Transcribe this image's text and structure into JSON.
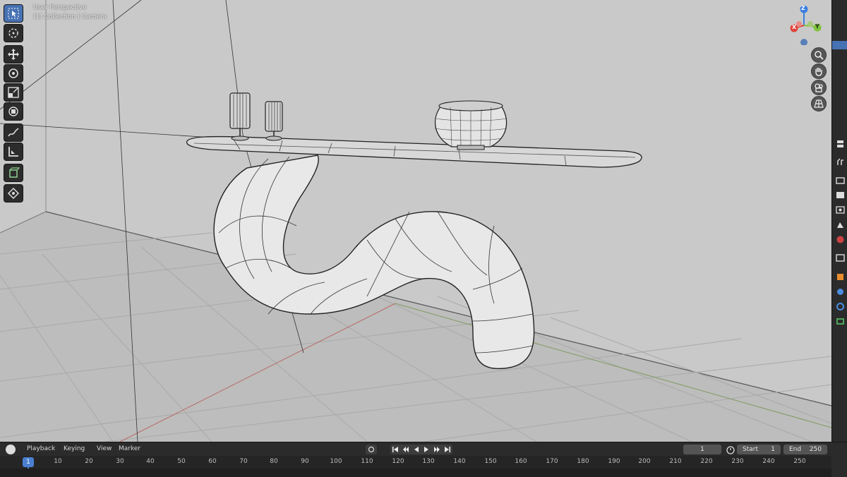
{
  "viewport": {
    "mode_label": "User Perspective",
    "collection_label": "(1) Collection | Camera",
    "gizmo_axes": {
      "z": "Z",
      "x": "X",
      "y": "Y"
    },
    "colors": {
      "x_axis": "#e0443c",
      "y_axis": "#7ec43a",
      "z_axis": "#3a7fe0",
      "background": "#c9c9c9",
      "floor": "#bebebe"
    }
  },
  "toolbar": {
    "tools": [
      "select-box-icon",
      "cursor-icon",
      "move-icon",
      "rotate-icon",
      "scale-icon",
      "transform-icon",
      "annotate-icon",
      "measure-icon",
      "add-cube-icon",
      "edit-object-icon"
    ]
  },
  "navigation": [
    "zoom-icon",
    "pan-hand-icon",
    "camera-view-icon",
    "orthographic-grid-icon"
  ],
  "properties_tabs": [
    "tool-icon",
    "render-icon",
    "output-icon",
    "view-layer-icon",
    "scene-icon",
    "world-icon",
    "collection-icon",
    "object-icon",
    "modifier-icon",
    "physics-icon",
    "data-icon"
  ],
  "timeline": {
    "menu": {
      "playback": "Playback",
      "keying": "Keying",
      "view": "View",
      "marker": "Marker"
    },
    "current_frame": "1",
    "start_label": "Start",
    "start_value": "1",
    "end_label": "End",
    "end_value": "250",
    "ruler": [
      "1",
      "10",
      "20",
      "30",
      "40",
      "50",
      "60",
      "70",
      "80",
      "90",
      "100",
      "110",
      "120",
      "130",
      "140",
      "150",
      "160",
      "170",
      "180",
      "190",
      "200",
      "210",
      "220",
      "230",
      "240",
      "250"
    ],
    "cursor_frame": "1"
  }
}
